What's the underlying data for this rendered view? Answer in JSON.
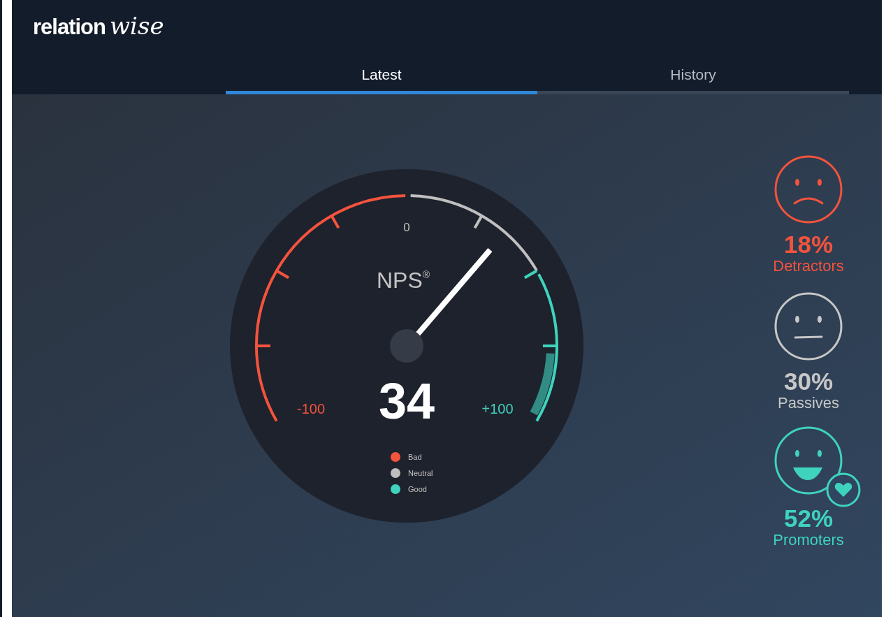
{
  "logo": {
    "primary": "relation",
    "secondary": "wise"
  },
  "tabs": [
    {
      "label": "Latest",
      "selected": true
    },
    {
      "label": "History",
      "selected": false
    }
  ],
  "gauge": {
    "title": "NPS",
    "title_mark": "®",
    "min_label": "-100",
    "zero_label": "0",
    "max_label": "+100",
    "reading": "34",
    "legend": [
      {
        "label": "Bad",
        "color": "#f4533d"
      },
      {
        "label": "Neutral",
        "color": "#bfbfbf"
      },
      {
        "label": "Good",
        "color": "#3fd3be"
      }
    ]
  },
  "segments": [
    {
      "kind": "detractors",
      "percent": "18%",
      "label": "Detractors",
      "color": "#f4533d"
    },
    {
      "kind": "passives",
      "percent": "30%",
      "label": "Passives",
      "color": "#c7c7c7"
    },
    {
      "kind": "promoters",
      "percent": "52%",
      "label": "Promoters",
      "color": "#3fd3be"
    }
  ]
}
